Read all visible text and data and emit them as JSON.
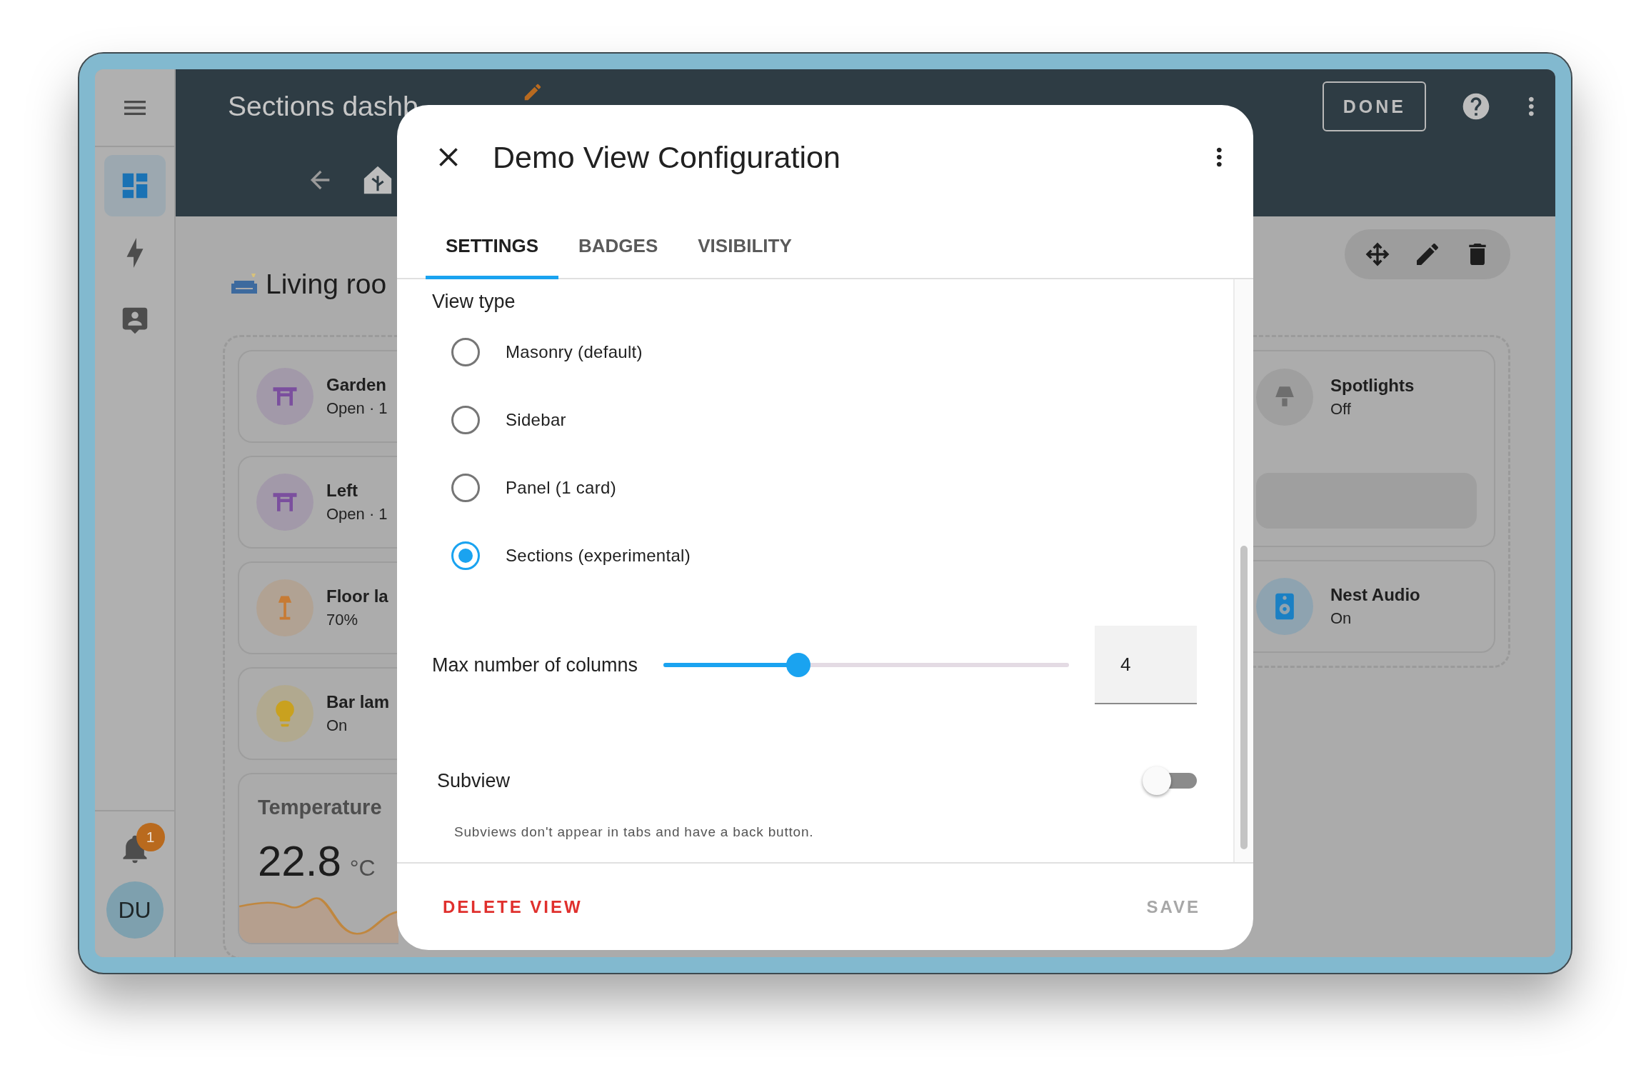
{
  "sidebar": {
    "items": [
      {
        "kind": "dashboard",
        "selected": true
      },
      {
        "kind": "energy",
        "selected": false
      },
      {
        "kind": "profile",
        "selected": false
      }
    ],
    "notification_badge": "1",
    "avatar": "DU"
  },
  "header": {
    "title": "Sections dashb",
    "done_button": "DONE"
  },
  "section_title": "Living roo",
  "left_cards": [
    {
      "kind": "gate",
      "name": "Garden",
      "state": "Open · 1",
      "color": "#7b4f9e"
    },
    {
      "kind": "gate",
      "name": "Left",
      "state": "Open · 1",
      "color": "#7b4f9e"
    },
    {
      "kind": "floor-lamp",
      "name": "Floor la",
      "state": "70%",
      "color": "#c77b34"
    },
    {
      "kind": "bulb",
      "name": "Bar lam",
      "state": "On",
      "color": "#c9a11f"
    }
  ],
  "temperature_card": {
    "title": "Temperature",
    "value": "22.8",
    "unit": "°C"
  },
  "right_cards": [
    {
      "kind": "spotlight",
      "name": "Spotlights",
      "state": "Off",
      "color": "#6e6e6e",
      "control": true
    },
    {
      "kind": "speaker",
      "name": "Nest Audio",
      "state": "On",
      "color": "#1a80c4",
      "control": false
    }
  ],
  "dialog": {
    "title": "Demo View Configuration",
    "tabs": [
      {
        "label": "SETTINGS",
        "selected": true
      },
      {
        "label": "BADGES",
        "selected": false
      },
      {
        "label": "VISIBILITY",
        "selected": false
      }
    ],
    "view_type_label": "View type",
    "view_types": [
      {
        "label": "Masonry (default)",
        "selected": false
      },
      {
        "label": "Sidebar",
        "selected": false
      },
      {
        "label": "Panel (1 card)",
        "selected": false
      },
      {
        "label": "Sections (experimental)",
        "selected": true
      }
    ],
    "columns": {
      "label": "Max number of columns",
      "level": 0.333,
      "value": "4"
    },
    "subview": {
      "label": "Subview",
      "on": false,
      "helper": "Subviews don't appear in tabs and have a back button."
    },
    "delete_button": "DELETE VIEW",
    "save": {
      "label": "SAVE",
      "disabled": true
    }
  }
}
